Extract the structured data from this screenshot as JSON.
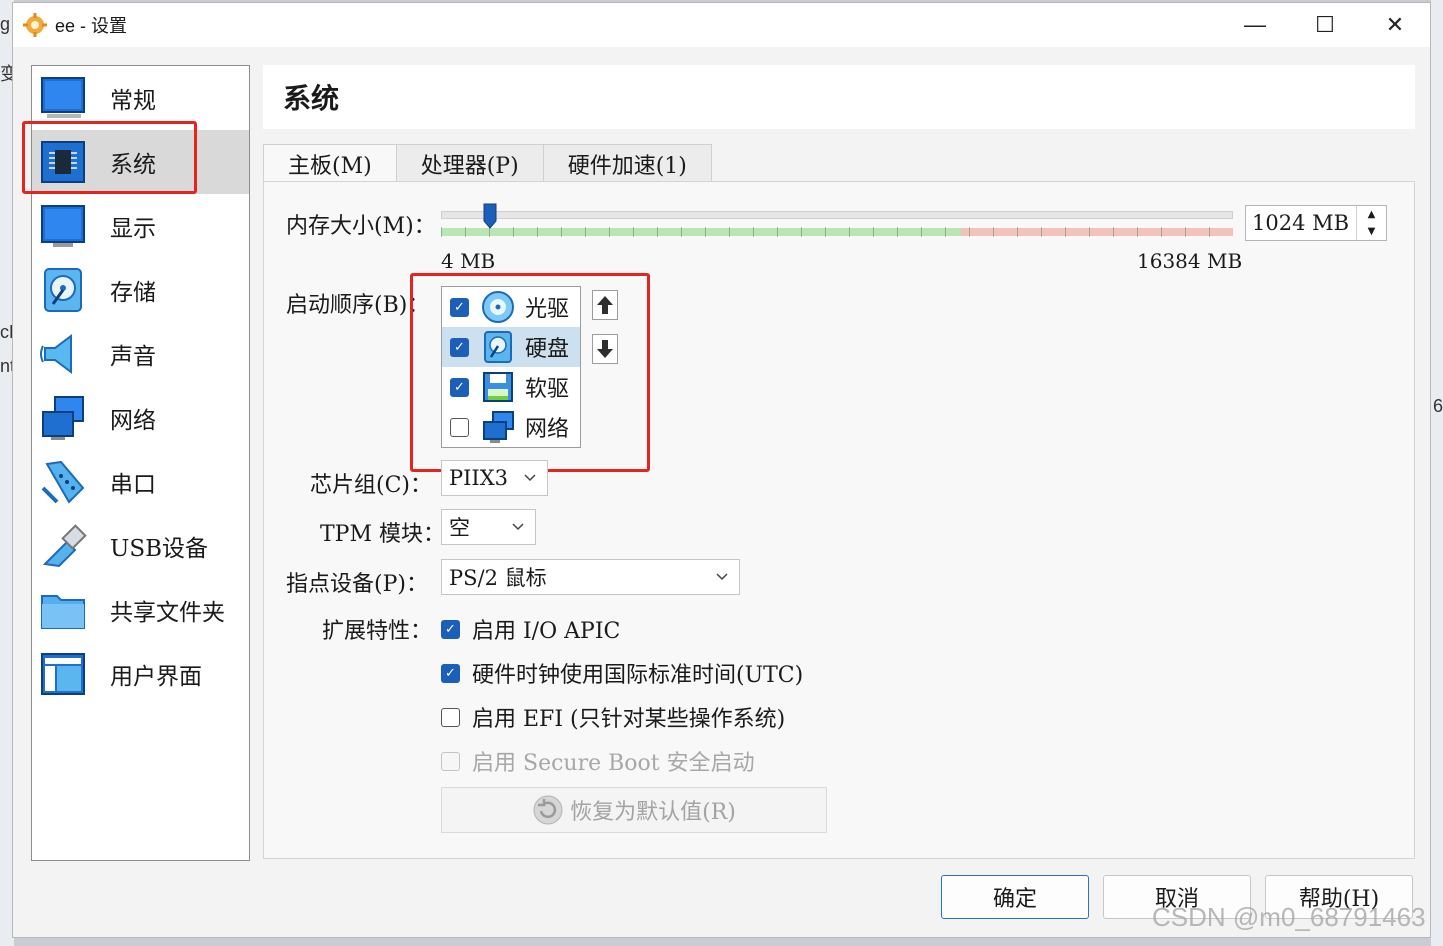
{
  "window": {
    "title": "ee - 设置",
    "minimize": "—",
    "maximize": "☐",
    "close": "✕"
  },
  "background": {
    "left_glyphs": [
      "g",
      "变",
      "cL",
      "nt"
    ],
    "right_glyphs": [
      "6"
    ]
  },
  "nav": {
    "items": [
      {
        "label": "常规",
        "icon": "general-icon"
      },
      {
        "label": "系统",
        "icon": "system-chip-icon",
        "selected": true
      },
      {
        "label": "显示",
        "icon": "display-icon"
      },
      {
        "label": "存储",
        "icon": "storage-icon"
      },
      {
        "label": "声音",
        "icon": "audio-icon"
      },
      {
        "label": "网络",
        "icon": "network-icon"
      },
      {
        "label": "串口",
        "icon": "serial-port-icon"
      },
      {
        "label": "USB设备",
        "icon": "usb-icon"
      },
      {
        "label": "共享文件夹",
        "icon": "shared-folder-icon"
      },
      {
        "label": "用户界面",
        "icon": "user-interface-icon"
      }
    ]
  },
  "page": {
    "title": "系统"
  },
  "tabs": [
    {
      "label": "主板(M)",
      "active": true
    },
    {
      "label": "处理器(P)"
    },
    {
      "label": "硬件加速(1)"
    }
  ],
  "motherboard": {
    "memory_label": "内存大小(M)：",
    "memory_min": "4 MB",
    "memory_max": "16384 MB",
    "memory_value": "1024 MB",
    "memory_fraction": 0.0622,
    "boot_label": "启动顺序(B)：",
    "boot_order": [
      {
        "label": "光驱",
        "checked": true,
        "icon": "optical-disc-icon"
      },
      {
        "label": "硬盘",
        "checked": true,
        "icon": "hard-disk-icon",
        "selected": true
      },
      {
        "label": "软驱",
        "checked": true,
        "icon": "floppy-icon"
      },
      {
        "label": "网络",
        "checked": false,
        "icon": "network-icon"
      }
    ],
    "chipset_label": "芯片组(C)：",
    "chipset_value": "PIIX3",
    "tpm_label": "TPM 模块：",
    "tpm_value": "空",
    "pointing_label": "指点设备(P)：",
    "pointing_value": "PS/2 鼠标",
    "ext_label": "扩展特性：",
    "ext_features": [
      {
        "label": "启用 I/O APIC",
        "checked": true
      },
      {
        "label": "硬件时钟使用国际标准时间(UTC)",
        "checked": true
      },
      {
        "label": "启用 EFI (只针对某些操作系统)",
        "checked": false
      },
      {
        "label": "启用 Secure Boot 安全启动",
        "checked": false,
        "disabled": true
      }
    ],
    "reset_label": "恢复为默认值(R)"
  },
  "buttons": {
    "ok": "确定",
    "cancel": "取消",
    "help": "帮助(H)"
  },
  "watermark": "CSDN @m0_68791463",
  "colors": {
    "accent": "#1c5fb8",
    "highlight_box": "#e5241f",
    "selected_row": "#cce0f0",
    "memory_safe": "#b9e6b4",
    "memory_danger": "#f2c3bc"
  }
}
